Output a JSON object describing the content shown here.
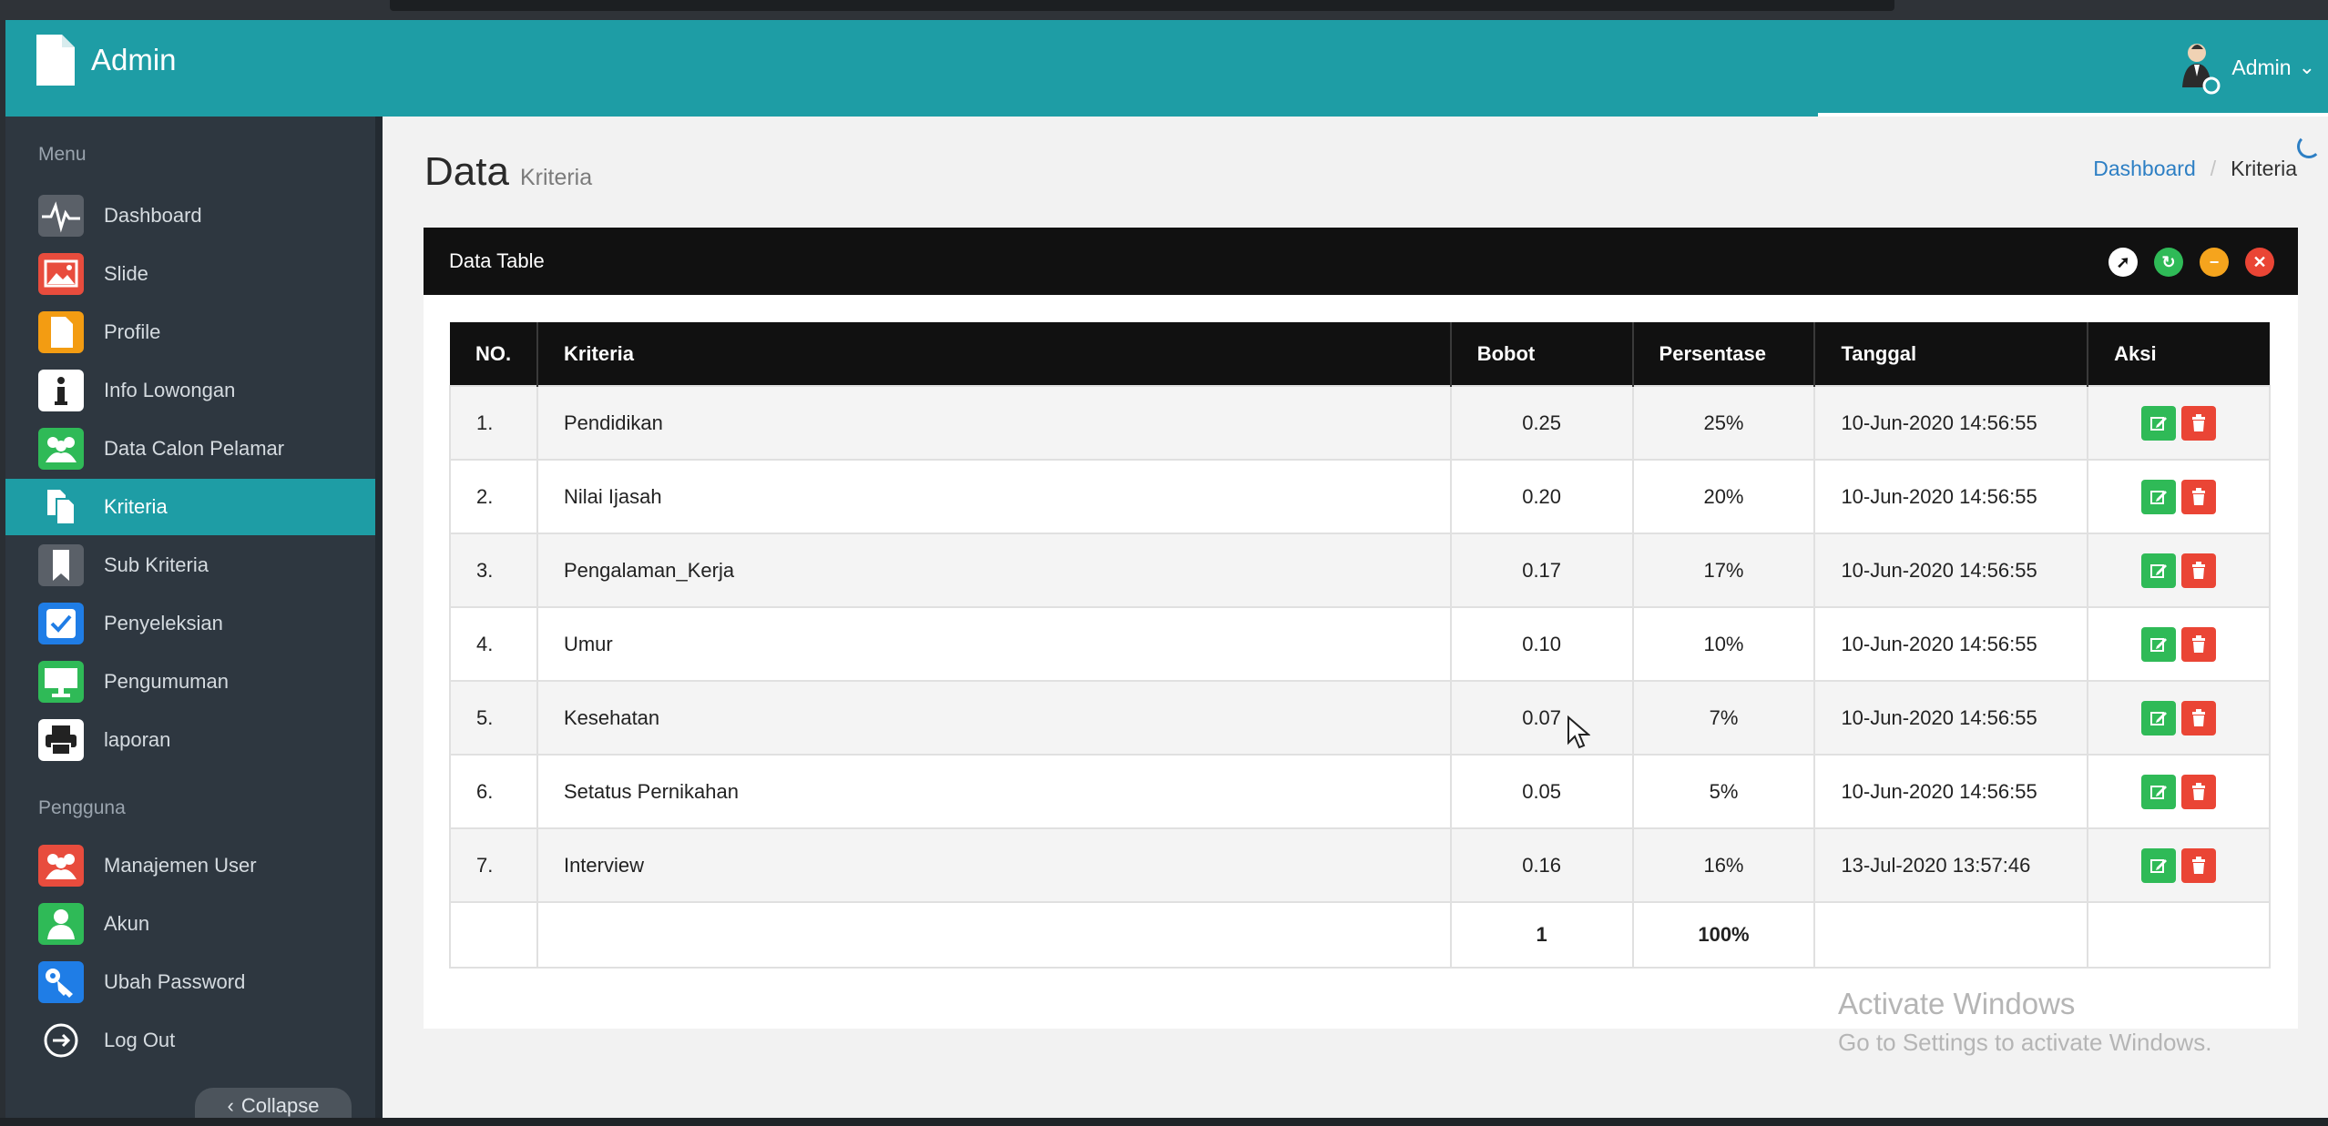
{
  "app": {
    "title": "Admin"
  },
  "user": {
    "name": "Admin"
  },
  "sidebar": {
    "section_menu": "Menu",
    "items": [
      {
        "label": "Dashboard",
        "icon": "pulse-icon",
        "color": "#5a6068"
      },
      {
        "label": "Slide",
        "icon": "image-icon",
        "color": "#e84c3d"
      },
      {
        "label": "Profile",
        "icon": "file-icon",
        "color": "#f39c12"
      },
      {
        "label": "Info Lowongan",
        "icon": "info-icon",
        "color": "#ffffff"
      },
      {
        "label": "Data Calon Pelamar",
        "icon": "users-icon",
        "color": "#2fba57"
      },
      {
        "label": "Kriteria",
        "icon": "copy-icon",
        "color": "#1e9da5"
      },
      {
        "label": "Sub Kriteria",
        "icon": "bookmark-icon",
        "color": "#5a6068"
      },
      {
        "label": "Penyeleksian",
        "icon": "checkbox-icon",
        "color": "#1f7de6"
      },
      {
        "label": "Pengumuman",
        "icon": "monitor-icon",
        "color": "#2fba57"
      },
      {
        "label": "laporan",
        "icon": "printer-icon",
        "color": "#ffffff"
      }
    ],
    "section_user": "Pengguna",
    "user_items": [
      {
        "label": "Manajemen User",
        "icon": "users-icon",
        "color": "#e84c3d"
      },
      {
        "label": "Akun",
        "icon": "user-icon",
        "color": "#2fba57"
      },
      {
        "label": "Ubah Password",
        "icon": "key-icon",
        "color": "#1f7de6"
      },
      {
        "label": "Log Out",
        "icon": "logout-icon",
        "color": "#2e3740"
      }
    ],
    "collapse_label": "Collapse"
  },
  "page": {
    "title": "Data",
    "subtitle": "Kriteria"
  },
  "breadcrumb": {
    "home": "Dashboard",
    "current": "Kriteria"
  },
  "panel": {
    "title": "Data Table"
  },
  "table": {
    "headers": [
      "NO.",
      "Kriteria",
      "Bobot",
      "Persentase",
      "Tanggal",
      "Aksi"
    ],
    "rows": [
      {
        "no": "1.",
        "kriteria": "Pendidikan",
        "bobot": "0.25",
        "persentase": "25%",
        "tanggal": "10-Jun-2020 14:56:55"
      },
      {
        "no": "2.",
        "kriteria": "Nilai Ijasah",
        "bobot": "0.20",
        "persentase": "20%",
        "tanggal": "10-Jun-2020 14:56:55"
      },
      {
        "no": "3.",
        "kriteria": "Pengalaman_Kerja",
        "bobot": "0.17",
        "persentase": "17%",
        "tanggal": "10-Jun-2020 14:56:55"
      },
      {
        "no": "4.",
        "kriteria": "Umur",
        "bobot": "0.10",
        "persentase": "10%",
        "tanggal": "10-Jun-2020 14:56:55"
      },
      {
        "no": "5.",
        "kriteria": "Kesehatan",
        "bobot": "0.07",
        "persentase": "7%",
        "tanggal": "10-Jun-2020 14:56:55"
      },
      {
        "no": "6.",
        "kriteria": "Setatus Pernikahan",
        "bobot": "0.05",
        "persentase": "5%",
        "tanggal": "10-Jun-2020 14:56:55"
      },
      {
        "no": "7.",
        "kriteria": "Interview",
        "bobot": "0.16",
        "persentase": "16%",
        "tanggal": "13-Jul-2020 13:57:46"
      }
    ],
    "total": {
      "bobot": "1",
      "persentase": "100%"
    }
  },
  "watermark": {
    "line1": "Activate Windows",
    "line2": "Go to Settings to activate Windows."
  },
  "colors": {
    "header": "#1e9da5",
    "sidebar": "#2e3740",
    "edit": "#2fba57",
    "delete": "#ea4535"
  }
}
